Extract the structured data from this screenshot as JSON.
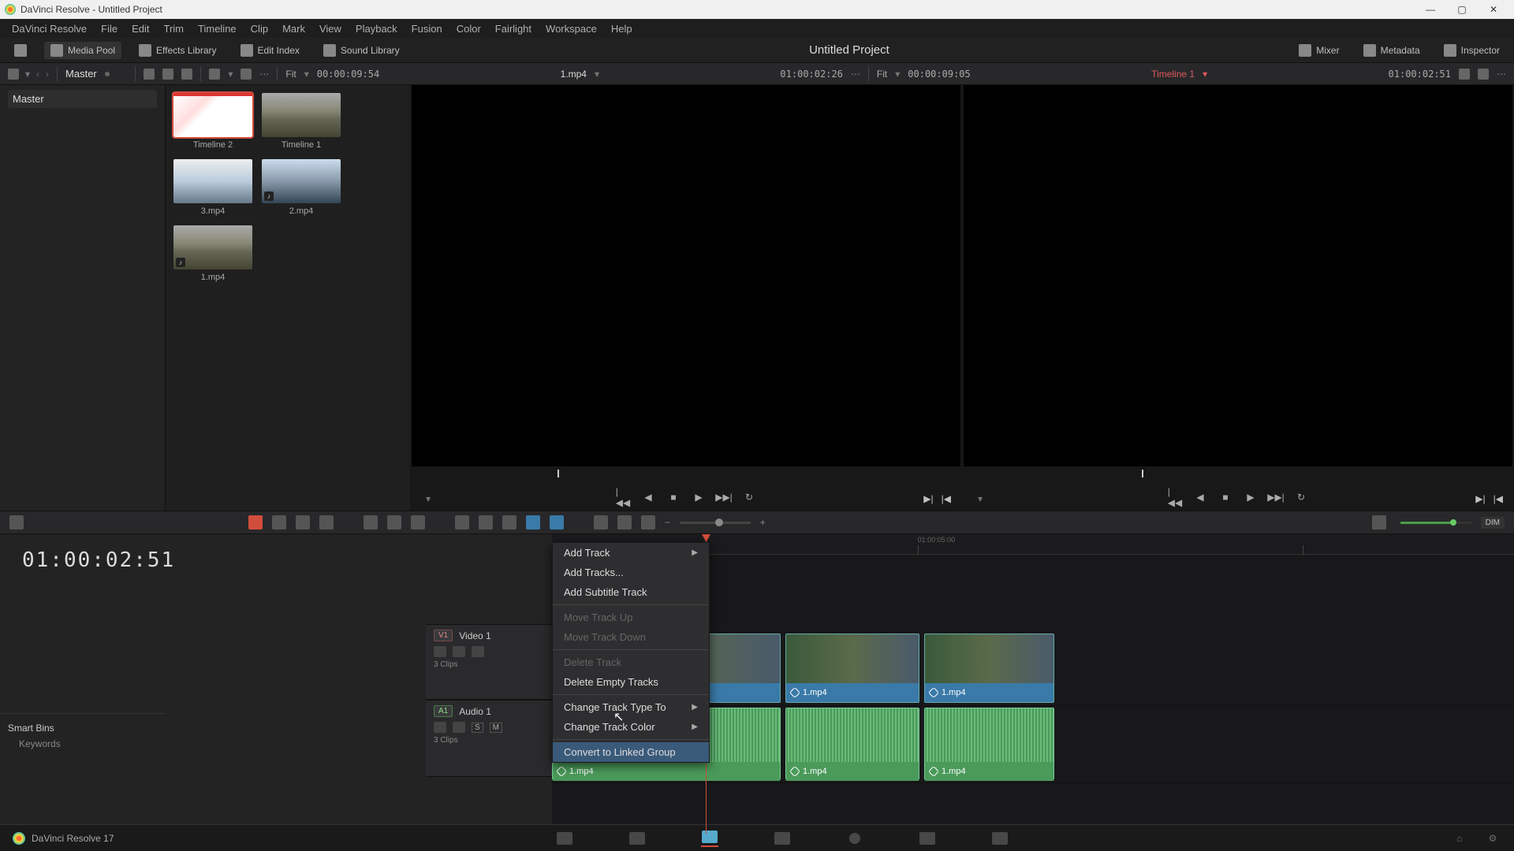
{
  "window": {
    "title": "DaVinci Resolve - Untitled Project"
  },
  "menubar": [
    "DaVinci Resolve",
    "File",
    "Edit",
    "Trim",
    "Timeline",
    "Clip",
    "Mark",
    "View",
    "Playback",
    "Fusion",
    "Color",
    "Fairlight",
    "Workspace",
    "Help"
  ],
  "toolbar": {
    "media_pool": "Media Pool",
    "effects_library": "Effects Library",
    "edit_index": "Edit Index",
    "sound_library": "Sound Library",
    "project_title": "Untitled Project",
    "mixer": "Mixer",
    "metadata": "Metadata",
    "inspector": "Inspector"
  },
  "options": {
    "bin_label": "Master",
    "src_zoom": "Fit",
    "src_tc": "00:00:09:54",
    "src_clip": "1.mp4",
    "src_pos": "01:00:02:26",
    "tl_zoom": "Fit",
    "tl_tc": "00:00:09:05",
    "tl_name": "Timeline 1",
    "tl_pos": "01:00:02:51"
  },
  "media_tree": {
    "root": "Master"
  },
  "media_items": [
    {
      "label": "Timeline 2",
      "sel": true,
      "art": "art-white"
    },
    {
      "label": "Timeline 1",
      "sel": false,
      "art": "art-road"
    },
    {
      "label": "3.mp4",
      "sel": false,
      "art": "art-beach"
    },
    {
      "label": "2.mp4",
      "sel": false,
      "art": "art-lake",
      "music": true
    },
    {
      "label": "1.mp4",
      "sel": false,
      "art": "art-road",
      "music": true
    }
  ],
  "smart_bins": {
    "title": "Smart Bins",
    "items": [
      "Keywords"
    ]
  },
  "timeline": {
    "timecode": "01:00:02:51",
    "video_track": {
      "tag": "V1",
      "name": "Video 1",
      "sub": "3 Clips"
    },
    "audio_track": {
      "tag": "A1",
      "name": "Audio 1",
      "sub": "3 Clips",
      "btn_s": "S",
      "btn_m": "M"
    },
    "clips": [
      {
        "label": "1.mp4"
      },
      {
        "label": "1.mp4"
      },
      {
        "label": "1.mp4"
      }
    ],
    "dim_label": "DIM"
  },
  "context_menu": {
    "items": [
      {
        "label": "Add Track",
        "arrow": true
      },
      {
        "label": "Add Tracks..."
      },
      {
        "label": "Add Subtitle Track"
      },
      {
        "sep": true
      },
      {
        "label": "Move Track Up",
        "disabled": true
      },
      {
        "label": "Move Track Down",
        "disabled": true
      },
      {
        "sep": true
      },
      {
        "label": "Delete Track",
        "disabled": true
      },
      {
        "label": "Delete Empty Tracks"
      },
      {
        "sep": true
      },
      {
        "label": "Change Track Type To",
        "arrow": true
      },
      {
        "label": "Change Track Color",
        "arrow": true
      },
      {
        "sep": true
      },
      {
        "label": "Convert to Linked Group",
        "hov": true
      }
    ]
  },
  "bottom": {
    "app": "DaVinci Resolve 17"
  }
}
